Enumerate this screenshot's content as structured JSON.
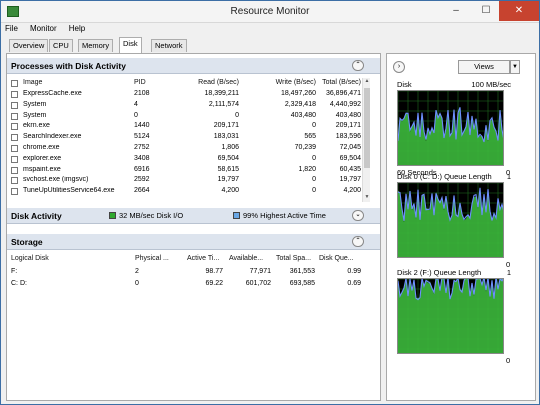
{
  "window": {
    "title": "Resource Monitor",
    "min": "–",
    "max": "☐",
    "close": "✕"
  },
  "menu": [
    "File",
    "Monitor",
    "Help"
  ],
  "tabs": [
    "Overview",
    "CPU",
    "Memory",
    "Disk",
    "Network"
  ],
  "active_tab": "Disk",
  "processes": {
    "title": "Processes with Disk Activity",
    "headers": {
      "image": "Image",
      "pid": "PID",
      "read": "Read (B/sec)",
      "write": "Write (B/sec)",
      "total": "Total (B/sec)"
    },
    "rows": [
      {
        "image": "ExpressCache.exe",
        "pid": "2108",
        "read": "18,399,211",
        "write": "18,497,260",
        "total": "36,896,471"
      },
      {
        "image": "System",
        "pid": "4",
        "read": "2,111,574",
        "write": "2,329,418",
        "total": "4,440,992"
      },
      {
        "image": "System",
        "pid": "0",
        "read": "0",
        "write": "403,480",
        "total": "403,480"
      },
      {
        "image": "ekrn.exe",
        "pid": "1440",
        "read": "209,171",
        "write": "0",
        "total": "209,171"
      },
      {
        "image": "SearchIndexer.exe",
        "pid": "5124",
        "read": "183,031",
        "write": "565",
        "total": "183,596"
      },
      {
        "image": "chrome.exe",
        "pid": "2752",
        "read": "1,806",
        "write": "70,239",
        "total": "72,045"
      },
      {
        "image": "explorer.exe",
        "pid": "3408",
        "read": "69,504",
        "write": "0",
        "total": "69,504"
      },
      {
        "image": "mspaint.exe",
        "pid": "6916",
        "read": "58,615",
        "write": "1,820",
        "total": "60,435"
      },
      {
        "image": "svchost.exe (imgsvc)",
        "pid": "2592",
        "read": "19,797",
        "write": "0",
        "total": "19,797"
      },
      {
        "image": "TuneUpUtilitiesService64.exe",
        "pid": "2664",
        "read": "4,200",
        "write": "0",
        "total": "4,200"
      }
    ]
  },
  "disk_activity": {
    "title": "Disk Activity",
    "io": "32 MB/sec Disk I/O",
    "active_time": "99% Highest Active Time",
    "io_color": "#2fa82f",
    "active_color": "#6aa8e6"
  },
  "storage": {
    "title": "Storage",
    "headers": {
      "logical": "Logical Disk",
      "physical": "Physical ...",
      "active": "Active Ti...",
      "available": "Available...",
      "total": "Total Spa...",
      "queue": "Disk Que..."
    },
    "rows": [
      {
        "logical": "F:",
        "physical": "2",
        "active": "98.77",
        "available": "77,971",
        "total": "361,553",
        "queue": "0.99"
      },
      {
        "logical": "C: D:",
        "physical": "0",
        "active": "69.22",
        "available": "601,702",
        "total": "693,585",
        "queue": "0.69"
      }
    ]
  },
  "side_panel": {
    "views_label": "Views",
    "graphs": [
      {
        "name": "Disk",
        "top_right": "100 MB/sec",
        "bottom_left": "60 Seconds",
        "bottom_right": "0",
        "level": 0.55
      },
      {
        "name": "Disk 0 (C: D:) Queue Length",
        "top_right": "1",
        "bottom_left": "",
        "bottom_right": "0",
        "level": 0.7
      },
      {
        "name": "Disk 2 (F:) Queue Length",
        "top_right": "1",
        "bottom_left": "",
        "bottom_right": "0",
        "level": 0.97
      }
    ],
    "colors": {
      "fill": "#3cb83c",
      "line": "#6d8fff",
      "grid": "#1f6e1f"
    }
  }
}
